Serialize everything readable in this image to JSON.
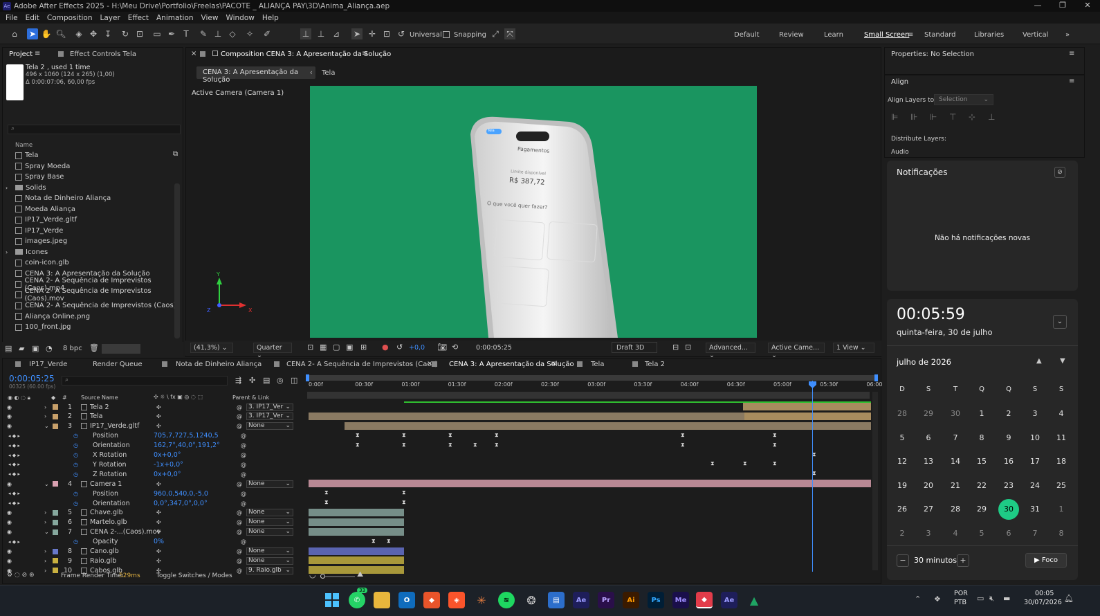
{
  "window": {
    "title": "Adobe After Effects 2025 - H:\\Meu Drive\\Portfolio\\Freelas\\PACOTE _ ALIANÇA PAY\\3D\\Anima_Aliança.aep",
    "icon": "Ae"
  },
  "menu": [
    "File",
    "Edit",
    "Composition",
    "Layer",
    "Effect",
    "Animation",
    "View",
    "Window",
    "Help"
  ],
  "toolbar": {
    "universal": "Universal",
    "snapping": "Snapping"
  },
  "workspaces": [
    "Default",
    "Review",
    "Learn",
    "Small Screen",
    "Standard",
    "Libraries",
    "Vertical"
  ],
  "project": {
    "tab": "Project",
    "effect_controls": "Effect Controls Tela",
    "item_name": "Tela 2",
    "item_used": ", used 1 time",
    "item_dims": "496 x 1060  (124 x 265) (1,00)",
    "item_dur": "Δ 0:00:07:06, 60,00 fps",
    "search_placeholder": "",
    "name_col": "Name",
    "items": [
      {
        "name": "Tela",
        "type": "comp"
      },
      {
        "name": "Spray Moeda",
        "type": "comp"
      },
      {
        "name": "Spray Base",
        "type": "comp"
      },
      {
        "name": "Solids",
        "type": "folder"
      },
      {
        "name": "Nota de Dinheiro Aliança",
        "type": "comp"
      },
      {
        "name": "Moeda Aliança",
        "type": "comp"
      },
      {
        "name": "IP17_Verde.gltf",
        "type": "file"
      },
      {
        "name": "IP17_Verde",
        "type": "comp"
      },
      {
        "name": "images.jpeg",
        "type": "file"
      },
      {
        "name": "Icones",
        "type": "folder"
      },
      {
        "name": "coin-icon.glb",
        "type": "file"
      },
      {
        "name": "CENA 3: A Apresentação da Solução",
        "type": "comp"
      },
      {
        "name": "CENA 2- A Sequência de Imprevistos (Caos).mp4",
        "type": "file"
      },
      {
        "name": "CENA 2- A Sequência de Imprevistos (Caos).mov",
        "type": "file"
      },
      {
        "name": "CENA 2- A Sequência de Imprevistos (Caos)",
        "type": "comp"
      },
      {
        "name": "Aliança Online.png",
        "type": "file"
      },
      {
        "name": "100_front.jpg",
        "type": "file"
      }
    ],
    "bpc": "8 bpc"
  },
  "comp": {
    "tab": "Composition CENA 3: A Apresentação da Solução",
    "crumb1": "CENA 3: A Apresentação da Solução",
    "crumb2": "Tela",
    "camera_label": "Active Camera (Camera 1)",
    "zoom": "(41,3%)",
    "resolution": "Quarter",
    "exposure": "+0,0",
    "timecode": "0:00:05:25",
    "renderer": "Draft 3D",
    "advanced": "Advanced...",
    "camera_select": "Active Came...",
    "view": "1 View",
    "phone": {
      "title": "Pagamentos",
      "badge": "Tela",
      "balance_label": "Limite disponível",
      "balance": "R$ 387,72",
      "question": "O que você quer fazer?"
    }
  },
  "properties": {
    "title": "Properties: No Selection",
    "align": "Align",
    "align_to_label": "Align Layers to:",
    "align_to_value": "Selection",
    "distribute": "Distribute Layers:",
    "audio": "Audio"
  },
  "notifications": {
    "title": "Notificações",
    "empty": "Não há notificações novas"
  },
  "clock": {
    "time": "00:05:59",
    "date": "quinta-feira, 30 de julho"
  },
  "calendar": {
    "month": "julho de 2026",
    "weekdays": [
      "D",
      "S",
      "T",
      "Q",
      "Q",
      "S",
      "S"
    ],
    "weeks": [
      [
        "28",
        "29",
        "30",
        "1",
        "2",
        "3",
        "4"
      ],
      [
        "5",
        "6",
        "7",
        "8",
        "9",
        "10",
        "11"
      ],
      [
        "12",
        "13",
        "14",
        "15",
        "16",
        "17",
        "18"
      ],
      [
        "19",
        "20",
        "21",
        "22",
        "23",
        "24",
        "25"
      ],
      [
        "26",
        "27",
        "28",
        "29",
        "30",
        "31",
        "1"
      ],
      [
        "2",
        "3",
        "4",
        "5",
        "6",
        "7",
        "8"
      ]
    ],
    "today": "30",
    "focus_minutes": "30 minutos",
    "focus_button": "Foco"
  },
  "timeline": {
    "tabs": [
      "IP17_Verde",
      "Render Queue",
      "Nota de Dinheiro Aliança",
      "CENA 2- A Sequência de Imprevistos (Caos)",
      "CENA 3: A Apresentação da Solução",
      "Tela",
      "Tela 2"
    ],
    "timecode": "0:00:05:25",
    "frames": "00325 (60.00 fps)",
    "col_source": "Source Name",
    "col_parent": "Parent & Link",
    "col_num": "#",
    "ruler": [
      "0:00f",
      "00:30f",
      "01:00f",
      "01:30f",
      "02:00f",
      "02:30f",
      "03:00f",
      "03:30f",
      "04:00f",
      "04:30f",
      "05:00f",
      "05:30f",
      "06:00"
    ],
    "rows": [
      {
        "num": "1",
        "name": "Tela 2",
        "parent": "3. IP17_Ver",
        "kind": "layer",
        "color": "#c8a06a"
      },
      {
        "num": "2",
        "name": "Tela",
        "parent": "3. IP17_Ver",
        "kind": "layer",
        "color": "#c8a06a"
      },
      {
        "num": "3",
        "name": "IP17_Verde.gltf",
        "parent": "None",
        "kind": "layer",
        "color": "#c8a06a"
      },
      {
        "num": "",
        "name": "Position",
        "value": "705,7,727,5,1240,5",
        "kind": "prop"
      },
      {
        "num": "",
        "name": "Orientation",
        "value": "162,7°,40,0°,191,2°",
        "kind": "prop"
      },
      {
        "num": "",
        "name": "X Rotation",
        "value": "0x+0,0°",
        "kind": "prop"
      },
      {
        "num": "",
        "name": "Y Rotation",
        "value": "-1x+0,0°",
        "kind": "prop"
      },
      {
        "num": "",
        "name": "Z Rotation",
        "value": "0x+0,0°",
        "kind": "prop"
      },
      {
        "num": "4",
        "name": "Camera 1",
        "parent": "None",
        "kind": "layer",
        "color": "#d8a0b0"
      },
      {
        "num": "",
        "name": "Position",
        "value": "960,0,540,0,-5,0",
        "kind": "prop"
      },
      {
        "num": "",
        "name": "Orientation",
        "value": "0,0°,347,0°,0,0°",
        "kind": "prop"
      },
      {
        "num": "5",
        "name": "Chave.glb",
        "parent": "None",
        "kind": "layer",
        "color": "#86a89e"
      },
      {
        "num": "6",
        "name": "Martelo.glb",
        "parent": "None",
        "kind": "layer",
        "color": "#86a89e"
      },
      {
        "num": "7",
        "name": "CENA 2-...(Caos).mov",
        "parent": "None",
        "kind": "layer",
        "color": "#86a89e"
      },
      {
        "num": "",
        "name": "Opacity",
        "value": "0%",
        "kind": "prop"
      },
      {
        "num": "8",
        "name": "Cano.glb",
        "parent": "None",
        "kind": "layer",
        "color": "#6878c8"
      },
      {
        "num": "9",
        "name": "Raio.glb",
        "parent": "None",
        "kind": "layer",
        "color": "#c8b040"
      },
      {
        "num": "10",
        "name": "Cabos.glb",
        "parent": "9. Raio.glb",
        "kind": "layer",
        "color": "#c8b040"
      }
    ],
    "render_time_label": "Frame Render Time:",
    "render_time": "529ms",
    "toggle": "Toggle Switches / Modes"
  },
  "taskbar": {
    "lang1": "POR",
    "lang2": "PTB",
    "time": "00:05",
    "date": "30/07/2026",
    "whatsapp_badge": "33",
    "apps": [
      {
        "label": "Ae",
        "color": "#1e1e5a",
        "fg": "#9b9bff"
      },
      {
        "label": "Pr",
        "color": "#2a0f4a",
        "fg": "#b9a3ff"
      },
      {
        "label": "Ai",
        "color": "#3a1a00",
        "fg": "#ff9a00"
      },
      {
        "label": "Ps",
        "color": "#001e36",
        "fg": "#31a8ff"
      },
      {
        "label": "Me",
        "color": "#1a0f4a",
        "fg": "#9f8fff"
      },
      {
        "label": "Ae",
        "color": "#1e1e5a",
        "fg": "#9b9bff"
      }
    ]
  }
}
